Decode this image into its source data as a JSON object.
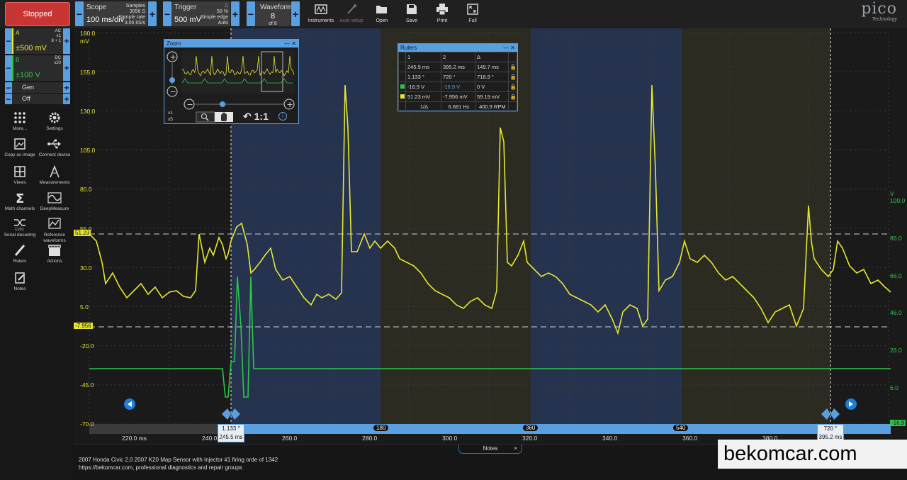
{
  "toolbar": {
    "run_state": "Stopped",
    "scope": {
      "label": "Scope",
      "timebase": "100 ms/div",
      "samples_label": "Samples",
      "samples_value": "3056 S",
      "rate_label": "Sample rate",
      "rate_value": "3.05 kS/s"
    },
    "trigger": {
      "label": "Trigger",
      "level": "500 mV",
      "pct": "50 %",
      "mode_line": "Simple edge",
      "mode": "Auto"
    },
    "waveform": {
      "label": "Waveform",
      "index": "8",
      "of": "of 8"
    },
    "tools": [
      {
        "label": "Instruments",
        "icon": "instruments-icon"
      },
      {
        "label": "Auto setup",
        "icon": "magic-wand-icon"
      },
      {
        "label": "Open",
        "icon": "folder-open-icon"
      },
      {
        "label": "Save",
        "icon": "save-icon"
      },
      {
        "label": "Print",
        "icon": "print-icon"
      },
      {
        "label": "Full",
        "icon": "fullscreen-icon"
      }
    ],
    "logo": {
      "word": "pico",
      "sub": "Technology"
    }
  },
  "channels": [
    {
      "name": "A",
      "range": "±500 mV",
      "coupling": "AC",
      "probe": "x1",
      "extra": "8 + 1",
      "color": "#e6e632"
    },
    {
      "name": "B",
      "range": "±100 V",
      "coupling": "DC",
      "probe": "x20",
      "color": "#2ec44a"
    }
  ],
  "generator": {
    "label": "Gen",
    "state": "Off"
  },
  "left_tools": [
    {
      "label": "More...",
      "icon": "more-dots-icon"
    },
    {
      "label": "Settings",
      "icon": "gear-icon"
    },
    {
      "label": "Copy as image",
      "icon": "image-icon"
    },
    {
      "label": "Connect device",
      "icon": "usb-icon"
    },
    {
      "label": "Views",
      "icon": "grid-views-icon"
    },
    {
      "label": "Measurements",
      "icon": "measurements-icon"
    },
    {
      "label": "Math channels",
      "icon": "sigma-icon"
    },
    {
      "label": "DeepMeasure",
      "icon": "deepmeasure-icon"
    },
    {
      "label": "Serial decoding",
      "icon": "serial-decoding-icon"
    },
    {
      "label": "Reference waveforms",
      "icon": "reference-waveforms-icon"
    },
    {
      "label": "Rulers",
      "icon": "ruler-icon"
    },
    {
      "label": "Actions",
      "icon": "clapper-icon"
    },
    {
      "label": "Notes",
      "icon": "notes-icon"
    }
  ],
  "scope_view": {
    "unit_a": "mV",
    "unit_b": "V",
    "y_ticks_a": [
      "180.0",
      "155.0",
      "130.0",
      "105.0",
      "80.0",
      "55.0",
      "30.0",
      "5.0",
      "-20.0",
      "-45.0",
      "-70.0"
    ],
    "y_ticks_b": [
      "100.0",
      "86.0",
      "66.0",
      "46.0",
      "26.0",
      "6.0"
    ],
    "x_ticks": [
      "220.0 ms",
      "240.0 ms",
      "260.0",
      "280.0",
      "300.0",
      "320.0",
      "340.0",
      "360.0",
      "380.0"
    ],
    "ruler_badges_a": [
      "51.23",
      "-7.956"
    ],
    "ruler_badge_b": "-16.9",
    "time_ruler_1": {
      "angle": "1.133 °",
      "time": "245.5 ms"
    },
    "time_ruler_2": {
      "angle": "720 °",
      "time": "395.2 ms"
    },
    "angle_marks": [
      "180",
      "360",
      "540"
    ]
  },
  "zoom_window": {
    "title": "Zoom",
    "zoom_x": "x1",
    "zoom_y": "x5",
    "reset": "1:1"
  },
  "rulers_window": {
    "title": "Rulers",
    "header": [
      "1",
      "2",
      "Δ"
    ],
    "rows": [
      {
        "c1": "245.5 ms",
        "c2": "395.2 ms",
        "d": "149.7 ms"
      },
      {
        "c1": "1.133 °",
        "c2": "720 °",
        "d": "718.9 °"
      },
      {
        "c1": "-16.9 V",
        "c2": "-16.9 V",
        "d": "0 V"
      },
      {
        "c1": "51.23 mV",
        "c2": "-7.956 mV",
        "d": "59.19 mV"
      }
    ],
    "freq": {
      "label": "1/Δ",
      "hz": "6.681 Hz",
      "rpm": "400.9 RPM"
    }
  },
  "bottom": {
    "notes_tab": "Notes",
    "notes_line1": "2007 Honda Civic 2.0 2007 K20 Map Sensor with Injector  #1 firing orde of 1342",
    "notes_line2": "https://bekomcar.com, professional diagnostics and repair groups",
    "watermark": "bekomcar.com"
  },
  "colors": {
    "chA": "#e6e632",
    "chB": "#2ec44a",
    "accent": "#5aa0e0",
    "stop": "#c83535"
  }
}
